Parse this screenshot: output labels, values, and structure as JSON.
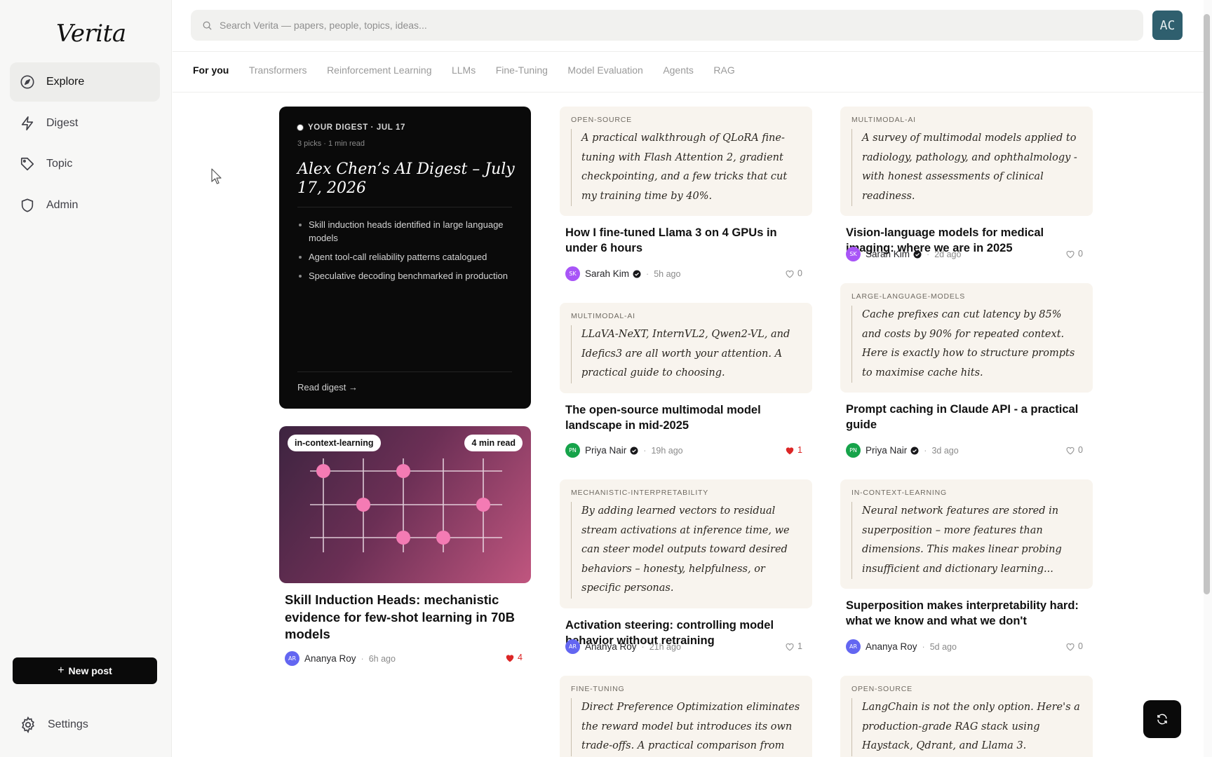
{
  "app": {
    "logo": "Verita"
  },
  "sidebar": {
    "items": [
      {
        "label": "Explore",
        "icon": "compass-icon",
        "active": true
      },
      {
        "label": "Digest",
        "icon": "lightning-icon"
      },
      {
        "label": "Topic",
        "icon": "tag-icon"
      },
      {
        "label": "Admin",
        "icon": "shield-icon"
      }
    ],
    "new_post": "New post",
    "settings": "Settings"
  },
  "search": {
    "placeholder": "Search Verita — papers, people, topics, ideas..."
  },
  "user": {
    "initials": "AC"
  },
  "tabs": [
    "For you",
    "Transformers",
    "Reinforcement Learning",
    "LLMs",
    "Fine-Tuning",
    "Model Evaluation",
    "Agents",
    "RAG"
  ],
  "digest": {
    "kicker": "YOUR DIGEST · JUL 17",
    "meta": "3 picks · 1 min read",
    "title": "Alex Chen’s AI Digest – July 17, 2026",
    "bullets": [
      "Skill induction heads identified in large language models",
      "Agent tool-call reliability patterns catalogued",
      "Speculative decoding benchmarked in production"
    ],
    "read": "Read digest →"
  },
  "featured": {
    "tag": "in-context-learning",
    "read_time": "4 min read",
    "title": "Skill Induction Heads: mechanistic evidence for few-shot learning in 70B models",
    "author": "Ananya Roy",
    "initials": "AR",
    "ago": "6h ago",
    "likes": "4"
  },
  "posts": [
    {
      "cat": "OPEN-SOURCE",
      "excerpt": "A practical walkthrough of QLoRA fine-tuning with Flash Attention 2, gradient checkpointing, and a few tricks that cut my training time by 40%.",
      "title": "How I fine-tuned Llama 3 on 4 GPUs in under 6 hours",
      "author": "Sarah Kim",
      "initials": "SK",
      "ago": "5h ago",
      "likes": "0"
    },
    {
      "cat": "MULTIMODAL-AI",
      "excerpt": "A survey of multimodal models applied to radiology, pathology, and ophthalmology - with honest assessments of clinical readiness.",
      "title": "Vision-language models for medical imaging: where we are in 2025",
      "author": "Sarah Kim",
      "initials": "SK",
      "ago": "2d ago",
      "likes": "0"
    },
    {
      "cat": "MULTIMODAL-AI",
      "excerpt": "LLaVA-NeXT, InternVL2, Qwen2-VL, and Idefics3 are all worth your attention. A practical guide to choosing.",
      "title": "The open-source multimodal model landscape in mid-2025",
      "author": "Priya Nair",
      "initials": "PN",
      "ago": "19h ago",
      "likes": "1"
    },
    {
      "cat": "LARGE-LANGUAGE-MODELS",
      "excerpt": "Cache prefixes can cut latency by 85% and costs by 90% for repeated context. Here is exactly how to structure prompts to maximise cache hits.",
      "title": "Prompt caching in Claude API - a practical guide",
      "author": "Priya Nair",
      "initials": "PN",
      "ago": "3d ago",
      "likes": "0"
    },
    {
      "cat": "MECHANISTIC-INTERPRETABILITY",
      "excerpt": "By adding learned vectors to residual stream activations at inference time, we can steer model outputs toward desired behaviors – honesty, helpfulness, or specific personas.",
      "title": "Activation steering: controlling model behavior without retraining",
      "author": "Ananya Roy",
      "initials": "AR",
      "ago": "21h ago",
      "likes": "1"
    },
    {
      "cat": "IN-CONTEXT-LEARNING",
      "excerpt": "Neural network features are stored in superposition – more features than dimensions. This makes linear probing insufficient and dictionary learning...",
      "title": "Superposition makes interpretability hard: what we know and what we don't",
      "author": "Ananya Roy",
      "initials": "AR",
      "ago": "5d ago",
      "likes": "0"
    },
    {
      "cat": "FINE-TUNING",
      "excerpt": "Direct Preference Optimization eliminates the reward model but introduces its own trade-offs. A practical comparison from"
    },
    {
      "cat": "OPEN-SOURCE",
      "excerpt": "LangChain is not the only option. Here's a production-grade RAG stack using Haystack, Qdrant, and Llama 3."
    }
  ],
  "colors": {
    "accent": "#0a0a0a",
    "avatar_bg": "#2f5f6e",
    "like_red": "#dc2626"
  }
}
